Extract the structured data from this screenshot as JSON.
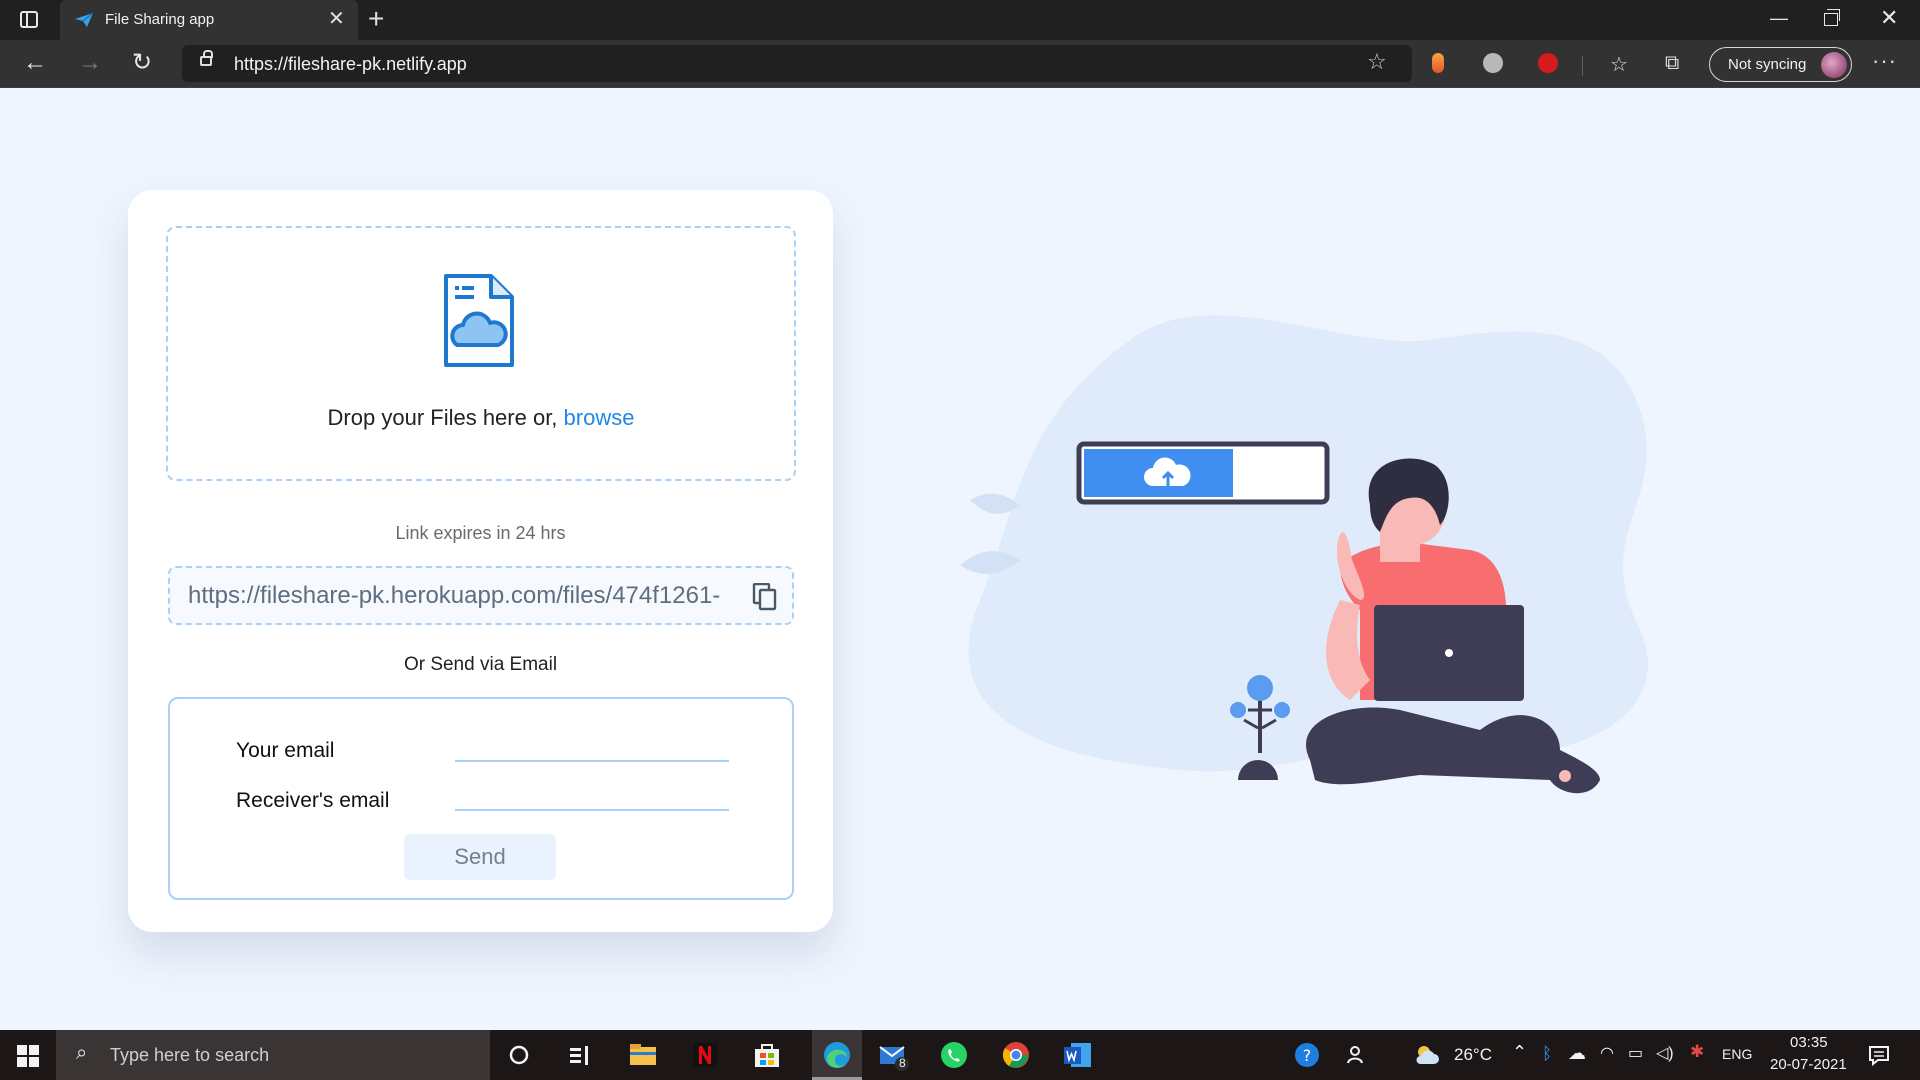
{
  "browser": {
    "tab_title": "File Sharing app",
    "tab_close": "✕",
    "new_tab": "+",
    "url": "https://fileshare-pk.netlify.app",
    "sync_label": "Not syncing",
    "more": "···",
    "window_controls": {
      "minimize": "—",
      "close": "✕"
    },
    "nav": {
      "back": "←",
      "forward": "→",
      "reload": "↻"
    }
  },
  "upload": {
    "drop_text": "Drop your Files here or, ",
    "browse_label": "browse"
  },
  "share": {
    "expiry_text": "Link expires in 24 hrs",
    "link_url": "https://fileshare-pk.herokuapp.com/files/474f1261-"
  },
  "email": {
    "heading": "Or Send via Email",
    "sender_label": "Your email",
    "receiver_label": "Receiver's email",
    "sender_value": "",
    "receiver_value": "",
    "send_label": "Send"
  },
  "taskbar": {
    "search_placeholder": "Type here to search",
    "mail_badge": "8",
    "temperature": "26°C",
    "language": "ENG",
    "time": "03:35",
    "date": "20-07-2021"
  },
  "colors": {
    "accent": "#1e88e5",
    "dashed_border": "#a9d0f5",
    "page_bg": "#eff5fe"
  }
}
